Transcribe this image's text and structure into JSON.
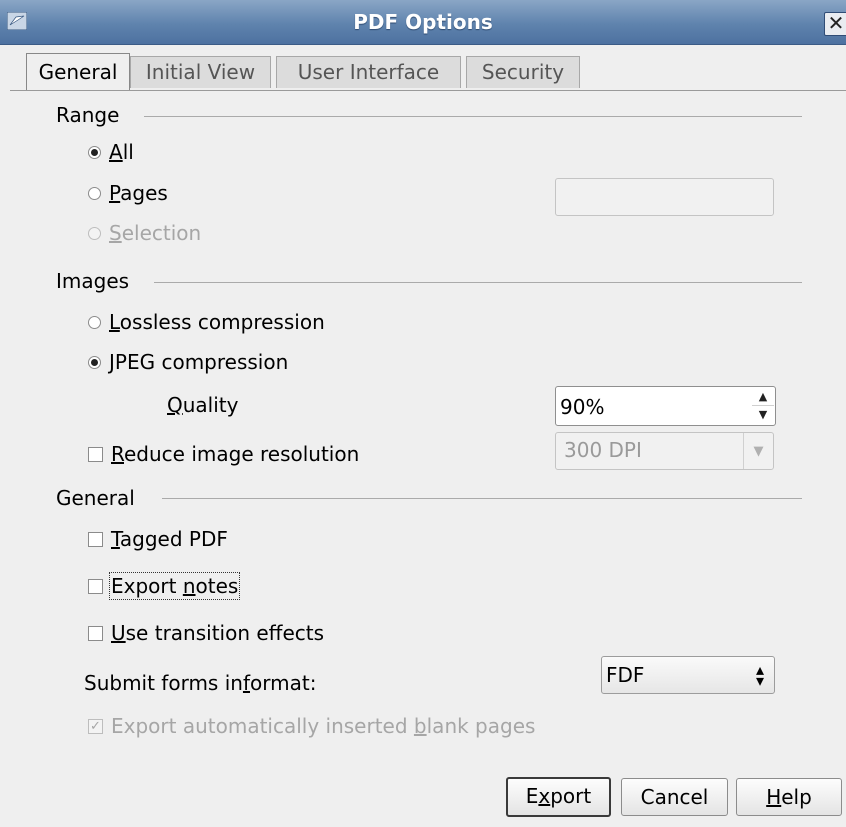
{
  "window": {
    "title": "PDF Options",
    "close_glyph": "✕"
  },
  "tabs": [
    {
      "label": "General",
      "active": true
    },
    {
      "label": "Initial View",
      "active": false
    },
    {
      "label": "User Interface",
      "active": false
    },
    {
      "label": "Security",
      "active": false
    }
  ],
  "range": {
    "label": "Range",
    "all": {
      "prefix": "",
      "ul": "A",
      "rest": "ll",
      "checked": true
    },
    "pages": {
      "prefix": "",
      "ul": "P",
      "rest": "ages",
      "checked": false,
      "value": ""
    },
    "selection": {
      "prefix": "",
      "ul": "S",
      "rest": "election",
      "checked": false,
      "enabled": false
    }
  },
  "images": {
    "label": "Images",
    "lossless": {
      "prefix": "",
      "ul": "L",
      "rest": "ossless compression",
      "checked": false
    },
    "jpeg": {
      "prefix": "",
      "ul": "J",
      "rest": "PEG compression",
      "checked": true
    },
    "quality": {
      "prefix": "",
      "ul": "Q",
      "rest": "uality",
      "value": "90%"
    },
    "reduce": {
      "prefix": "",
      "ul": "R",
      "rest": "educe image resolution",
      "checked": false,
      "dpi": "300 DPI"
    }
  },
  "general": {
    "label": "General",
    "tagged": {
      "prefix": "",
      "ul": "T",
      "rest": "agged PDF",
      "checked": false
    },
    "notes": {
      "prefix": "Export ",
      "ul": "n",
      "rest": "otes",
      "checked": false
    },
    "transitions": {
      "prefix": "",
      "ul": "U",
      "rest": "se transition effects",
      "checked": false
    },
    "submit": {
      "prefix": "Submit forms in ",
      "ul": "f",
      "rest": "ormat:",
      "value": "FDF"
    },
    "blank_pages": {
      "prefix": "Export automatically inserted ",
      "ul": "b",
      "rest": "lank pages",
      "checked": true,
      "enabled": false
    }
  },
  "buttons": {
    "export": {
      "prefix": "E",
      "ul": "x",
      "rest": "port"
    },
    "cancel": {
      "label": "Cancel"
    },
    "help": {
      "prefix": "",
      "ul": "H",
      "rest": "elp"
    }
  },
  "colors": {
    "titlebar": "#5f83ad",
    "dialog_bg": "#efefef",
    "disabled_text": "#a6a6a6"
  },
  "icons": {
    "app": "pdf-options-window-icon",
    "close": "close-icon",
    "spin_up": "chevron-up-icon",
    "spin_down": "chevron-down-icon",
    "dropdown": "dropdown-arrow-icon",
    "updown": "updown-arrows-icon"
  }
}
